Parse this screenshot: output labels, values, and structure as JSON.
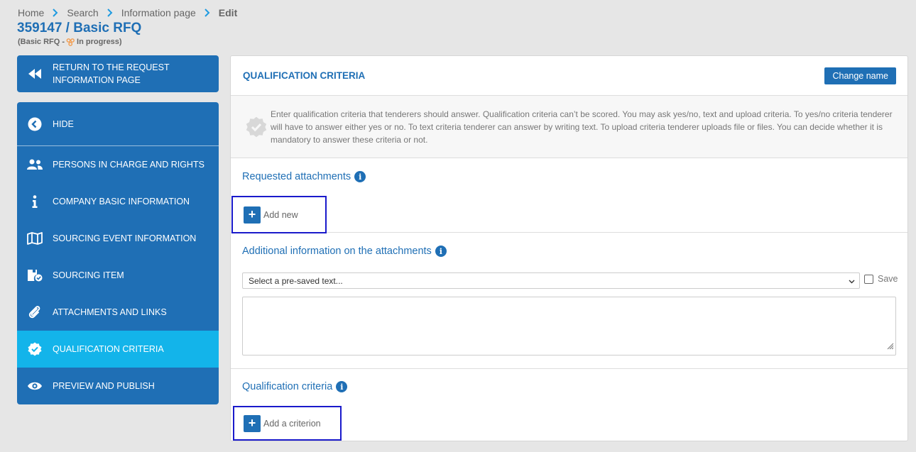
{
  "breadcrumb": {
    "items": [
      "Home",
      "Search",
      "Information page"
    ],
    "current": "Edit"
  },
  "page": {
    "title": "359147 / Basic RFQ",
    "subtitle_prefix": "(Basic RFQ - ",
    "subtitle_status": "In progress)"
  },
  "sidebar": {
    "return_label": "RETURN TO THE REQUEST INFORMATION PAGE",
    "items": [
      {
        "label": "HIDE",
        "icon": "chevron-left-circle-icon"
      },
      {
        "label": "PERSONS IN CHARGE AND RIGHTS",
        "icon": "users-icon"
      },
      {
        "label": "COMPANY BASIC INFORMATION",
        "icon": "info-icon"
      },
      {
        "label": "SOURCING EVENT INFORMATION",
        "icon": "map-icon"
      },
      {
        "label": "SOURCING ITEM",
        "icon": "box-check-icon"
      },
      {
        "label": "ATTACHMENTS AND LINKS",
        "icon": "paperclip-icon"
      },
      {
        "label": "QUALIFICATION CRITERIA",
        "icon": "badge-check-icon"
      },
      {
        "label": "PREVIEW AND PUBLISH",
        "icon": "eye-icon"
      }
    ],
    "active_index": 6
  },
  "main": {
    "title": "QUALIFICATION CRITERIA",
    "change_name_label": "Change name",
    "info_text": "Enter qualification criteria that tenderers should answer. Qualification criteria can’t be scored. You may ask yes/no, text and upload criteria. To yes/no criteria tenderer will have to answer either yes or no. To text criteria tenderer can answer by writing text. To upload criteria tenderer uploads file or files. You can decide whether it is mandatory to answer these criteria or not.",
    "requested_attachments": {
      "title": "Requested attachments",
      "add_label": "Add new"
    },
    "additional_info": {
      "title": "Additional information on the attachments",
      "select_value": "Select a pre-saved text...",
      "save_label": "Save",
      "text_value": ""
    },
    "qualification_criteria": {
      "title": "Qualification criteria",
      "add_label": "Add a criterion"
    }
  },
  "colors": {
    "brand": "#1f6fb5",
    "active": "#13b4ea",
    "highlight_border": "#1a1acb",
    "status": "#f39a4a"
  }
}
